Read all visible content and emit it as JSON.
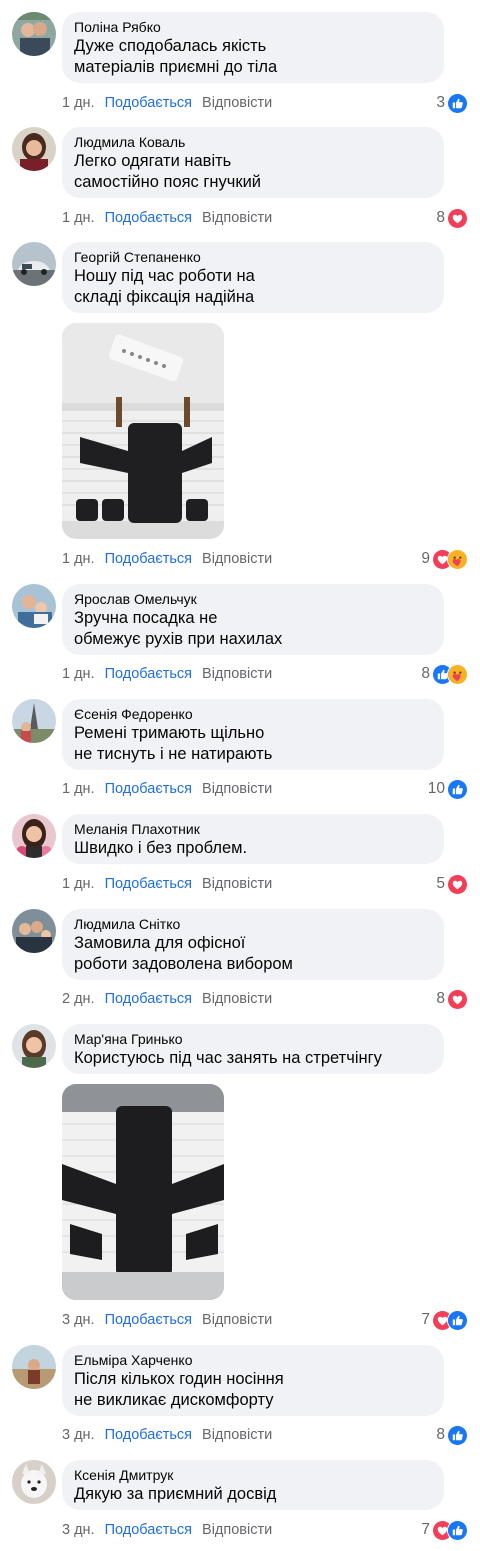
{
  "comments": [
    {
      "author": "Поліна Рябко",
      "text": "Дуже сподобалась якість\nматеріалів приємні до тіла",
      "time": "1 дн.",
      "like": "Подобається",
      "reply": "Відповісти",
      "count": "3",
      "reactions": [
        "like-icon"
      ]
    },
    {
      "author": "Людмила Коваль",
      "text": "Легко одягати навіть\nсамостійно пояс гнучкий",
      "time": "1 дн.",
      "like": "Подобається",
      "reply": "Відповісти",
      "count": "8",
      "reactions": [
        "love-icon"
      ]
    },
    {
      "author": "Георгій Степаненко",
      "text": "Ношу під час роботи на\nскладі фіксація надійна",
      "time": "1 дн.",
      "like": "Подобається",
      "reply": "Відповісти",
      "count": "9",
      "reactions": [
        "love-icon",
        "care-icon"
      ]
    },
    {
      "author": "Ярослав Омельчук",
      "text": "Зручна посадка не\nобмежує рухів при нахилах",
      "time": "1 дн.",
      "like": "Подобається",
      "reply": "Відповісти",
      "count": "8",
      "reactions": [
        "like-icon",
        "care-icon"
      ]
    },
    {
      "author": "Єсенія Федоренко",
      "text": "Ремені тримають щільно\nне тиснуть і не натирають",
      "time": "1 дн.",
      "like": "Подобається",
      "reply": "Відповісти",
      "count": "10",
      "reactions": [
        "like-icon"
      ]
    },
    {
      "author": "Меланія Плахотник",
      "text": "Швидко і без проблем.",
      "time": "1 дн.",
      "like": "Подобається",
      "reply": "Відповісти",
      "count": "5",
      "reactions": [
        "love-icon"
      ]
    },
    {
      "author": "Людмила Снітко",
      "text": "Замовила для офісної\nроботи задоволена вибором",
      "time": "2 дн.",
      "like": "Подобається",
      "reply": "Відповісти",
      "count": "8",
      "reactions": [
        "love-icon"
      ]
    },
    {
      "author": "Мар'яна Гринько",
      "text": "Користуюсь під час занять на стретчінгу",
      "time": "3 дн.",
      "like": "Подобається",
      "reply": "Відповісти",
      "count": "7",
      "reactions": [
        "love-icon",
        "like-icon"
      ]
    },
    {
      "author": "Ельміра Харченко",
      "text": "Після кількох годин носіння\nне викликає дискомфорту",
      "time": "3 дн.",
      "like": "Подобається",
      "reply": "Відповісти",
      "count": "8",
      "reactions": [
        "like-icon"
      ]
    },
    {
      "author": "Ксенія Дмитрук",
      "text": "Дякую за приємний досвід",
      "time": "3 дн.",
      "like": "Подобається",
      "reply": "Відповісти",
      "count": "7",
      "reactions": [
        "love-icon",
        "like-icon"
      ]
    }
  ],
  "colors": {
    "like_blue": "#216fdb",
    "love_red": "#f33e58",
    "bubble": "#f0f2f5",
    "meta_gray": "#65676b"
  }
}
